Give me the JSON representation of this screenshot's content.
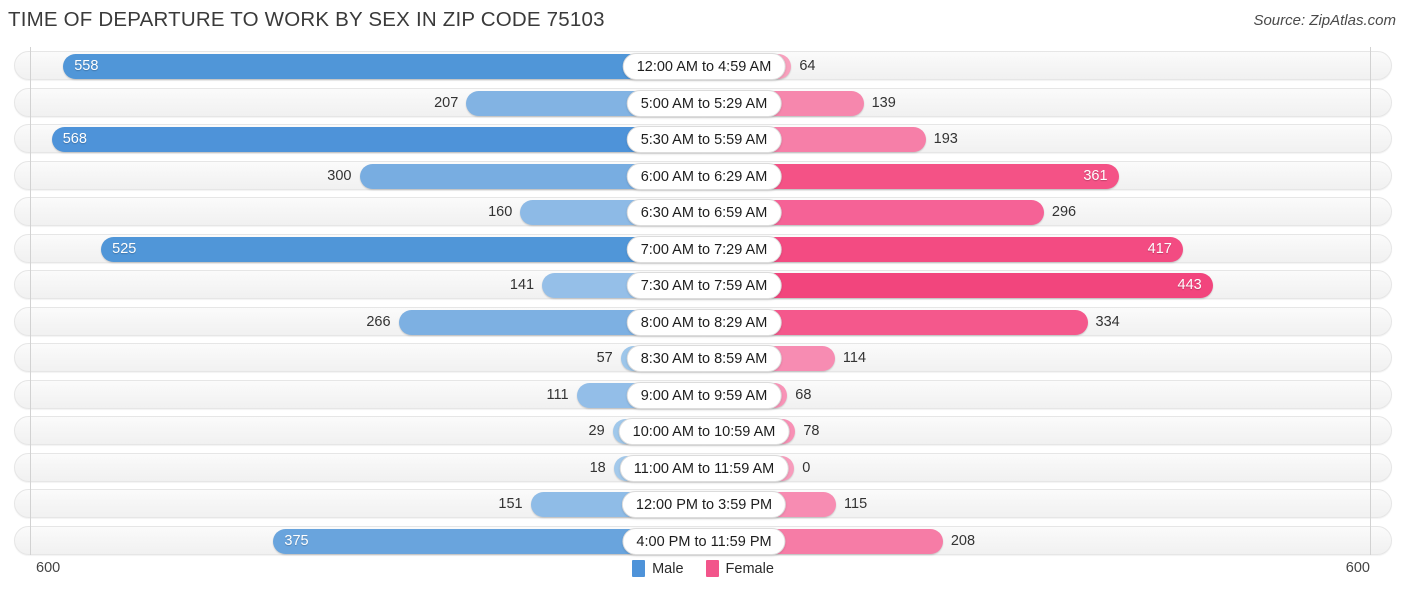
{
  "header": {
    "title": "TIME OF DEPARTURE TO WORK BY SEX IN ZIP CODE 75103",
    "source": "Source: ZipAtlas.com"
  },
  "legend": {
    "items": [
      {
        "label": "Male",
        "color": "#4e93d9"
      },
      {
        "label": "Female",
        "color": "#f2558b"
      }
    ]
  },
  "axis": {
    "left_tick": "600",
    "right_tick": "600"
  },
  "chart_data": {
    "type": "bar",
    "orientation": "horizontal-diverging",
    "title": "TIME OF DEPARTURE TO WORK BY SEX IN ZIP CODE 75103",
    "xlabel": "",
    "ylabel": "",
    "xlim": [
      600,
      600
    ],
    "grid": false,
    "legend_position": "bottom-center",
    "categories": [
      "12:00 AM to 4:59 AM",
      "5:00 AM to 5:29 AM",
      "5:30 AM to 5:59 AM",
      "6:00 AM to 6:29 AM",
      "6:30 AM to 6:59 AM",
      "7:00 AM to 7:29 AM",
      "7:30 AM to 7:59 AM",
      "8:00 AM to 8:29 AM",
      "8:30 AM to 8:59 AM",
      "9:00 AM to 9:59 AM",
      "10:00 AM to 10:59 AM",
      "11:00 AM to 11:59 AM",
      "12:00 PM to 3:59 PM",
      "4:00 PM to 11:59 PM"
    ],
    "series": [
      {
        "name": "Male",
        "color": "#4e93d9",
        "values": [
          558,
          207,
          568,
          300,
          160,
          525,
          141,
          266,
          57,
          111,
          29,
          18,
          151,
          375
        ]
      },
      {
        "name": "Female",
        "color": "#f2558b",
        "values": [
          64,
          139,
          193,
          361,
          296,
          417,
          443,
          334,
          114,
          68,
          78,
          0,
          115,
          208
        ]
      }
    ]
  },
  "rows": [
    {
      "label": "12:00 AM to 4:59 AM",
      "male": 558,
      "female": 64,
      "male_text": "558",
      "female_text": "64",
      "male_inside": true,
      "female_inside": false,
      "male_color": "#5096d8",
      "female_color": "#f8a0bd"
    },
    {
      "label": "5:00 AM to 5:29 AM",
      "male": 207,
      "female": 139,
      "male_text": "207",
      "female_text": "139",
      "male_inside": false,
      "female_inside": false,
      "male_color": "#82b3e3",
      "female_color": "#f687ad"
    },
    {
      "label": "5:30 AM to 5:59 AM",
      "male": 568,
      "female": 193,
      "male_text": "568",
      "female_text": "193",
      "male_inside": true,
      "female_inside": false,
      "male_color": "#4e93d9",
      "female_color": "#f67fa8"
    },
    {
      "label": "6:00 AM to 6:29 AM",
      "male": 300,
      "female": 361,
      "male_text": "300",
      "female_text": "361",
      "male_inside": false,
      "female_inside": true,
      "male_color": "#78adE1",
      "female_color": "#f45286"
    },
    {
      "label": "6:30 AM to 6:59 AM",
      "male": 160,
      "female": 296,
      "male_text": "160",
      "female_text": "296",
      "male_inside": false,
      "female_inside": false,
      "male_color": "#8dbae6",
      "female_color": "#f56296"
    },
    {
      "label": "7:00 AM to 7:29 AM",
      "male": 525,
      "female": 417,
      "male_text": "525",
      "female_text": "417",
      "male_inside": true,
      "female_inside": true,
      "male_color": "#5096d8",
      "female_color": "#f34b82"
    },
    {
      "label": "7:30 AM to 7:59 AM",
      "male": 141,
      "female": 443,
      "male_text": "141",
      "female_text": "443",
      "male_inside": false,
      "female_inside": true,
      "male_color": "#95bfe8",
      "female_color": "#f2457d"
    },
    {
      "label": "8:00 AM to 8:29 AM",
      "male": 266,
      "female": 334,
      "male_text": "266",
      "female_text": "334",
      "male_inside": false,
      "female_inside": false,
      "male_color": "#7db0e2",
      "female_color": "#f4588c"
    },
    {
      "label": "8:30 AM to 8:59 AM",
      "male": 57,
      "female": 114,
      "male_text": "57",
      "female_text": "114",
      "male_inside": false,
      "female_inside": false,
      "male_color": "#9dc6ea",
      "female_color": "#f78cb2"
    },
    {
      "label": "9:00 AM to 9:59 AM",
      "male": 111,
      "female": 68,
      "male_text": "111",
      "female_text": "68",
      "male_inside": false,
      "female_inside": false,
      "male_color": "#93bee8",
      "female_color": "#f893b7"
    },
    {
      "label": "10:00 AM to 10:59 AM",
      "male": 29,
      "female": 78,
      "male_text": "29",
      "female_text": "78",
      "male_inside": false,
      "female_inside": false,
      "male_color": "#a0c8eb",
      "female_color": "#f890b5"
    },
    {
      "label": "11:00 AM to 11:59 AM",
      "male": 18,
      "female": 0,
      "male_text": "18",
      "female_text": "0",
      "male_inside": false,
      "female_inside": false,
      "male_color": "#a3c9eb",
      "female_color": "#f79cbc"
    },
    {
      "label": "12:00 PM to 3:59 PM",
      "male": 151,
      "female": 115,
      "male_text": "151",
      "female_text": "115",
      "male_inside": false,
      "female_inside": false,
      "male_color": "#8fbce7",
      "female_color": "#f78cb2"
    },
    {
      "label": "4:00 PM to 11:59 PM",
      "male": 375,
      "female": 208,
      "male_text": "375",
      "female_text": "208",
      "male_inside": true,
      "female_inside": false,
      "male_color": "#69a4dd",
      "female_color": "#f67ca6"
    }
  ]
}
